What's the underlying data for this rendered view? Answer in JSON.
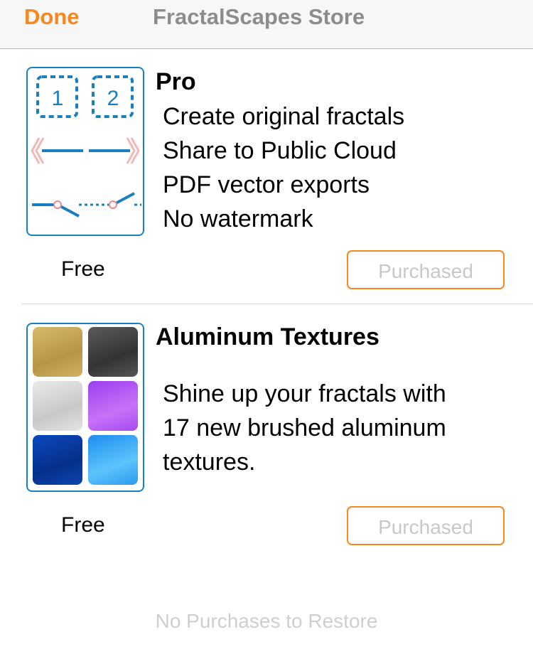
{
  "nav": {
    "done_label": "Done",
    "title": "FractalScapes Store"
  },
  "products": [
    {
      "title": "Pro",
      "description_lines": [
        "Create original fractals",
        "Share to Public Cloud",
        "PDF vector exports",
        "No watermark"
      ],
      "price": "Free",
      "button_label": "Purchased",
      "icon": "rule-diagram-icon",
      "badge_labels": [
        "1",
        "2"
      ]
    },
    {
      "title": "Aluminum Textures",
      "description_lines": [
        "Shine up your fractals with",
        "17 new brushed aluminum",
        "textures."
      ],
      "price": "Free",
      "button_label": "Purchased",
      "icon": "texture-swatches-icon",
      "swatch_colors": [
        "#c9a85a",
        "#4a4a4a",
        "#d9d9d9",
        "#b255f2",
        "#0a3ea8",
        "#34a6f5"
      ]
    }
  ],
  "restore_label": "No Purchases to Restore",
  "colors": {
    "accent": "#f5891f",
    "thumb_border": "#1a7fc1",
    "disabled_text": "#c8c8c8"
  }
}
